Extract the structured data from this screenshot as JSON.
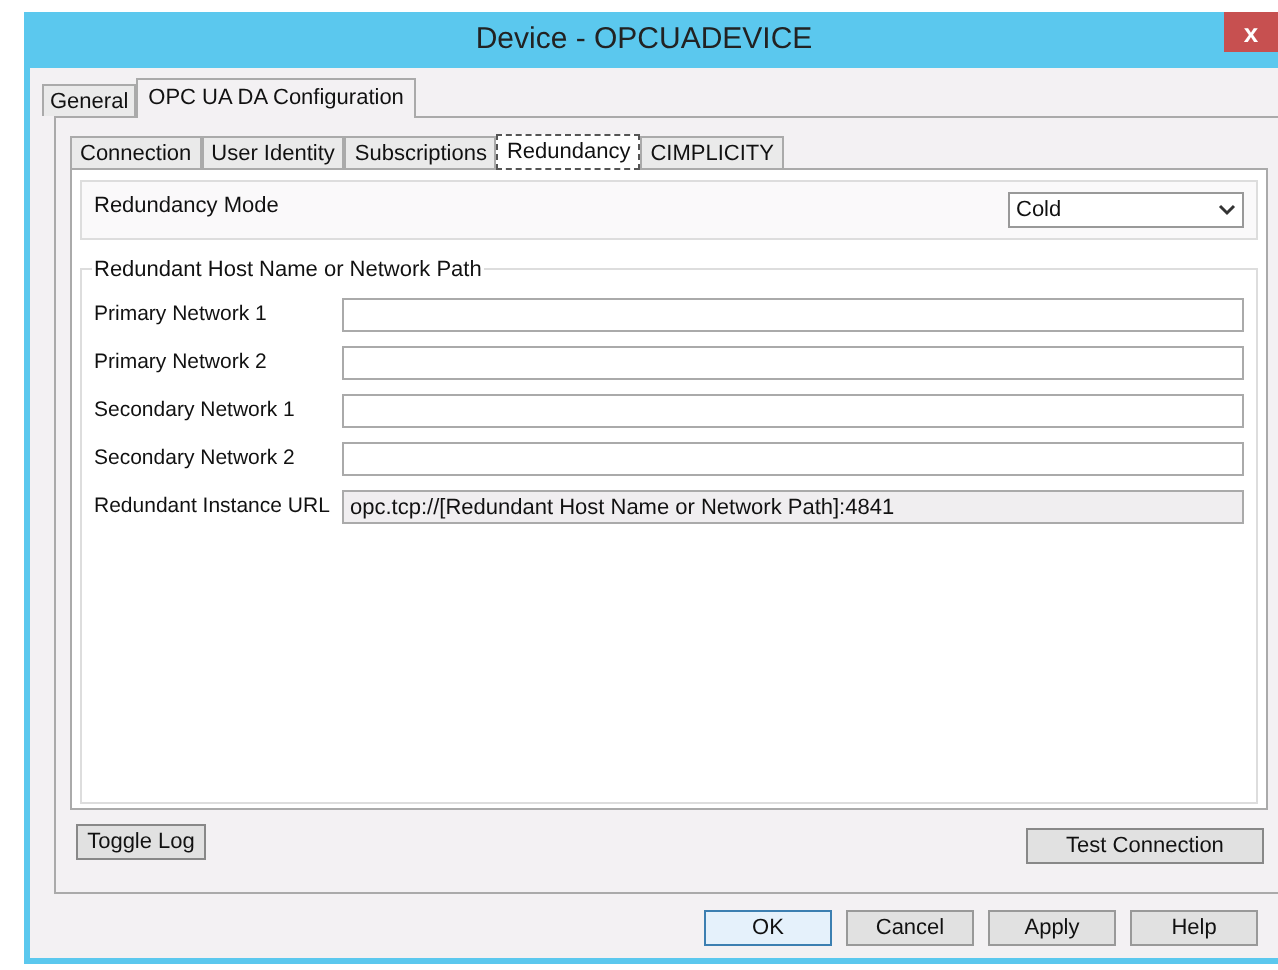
{
  "window": {
    "title": "Device - OPCUADEVICE",
    "close": "x"
  },
  "outer_tabs": [
    {
      "label": "General",
      "selected": false
    },
    {
      "label": "OPC UA DA Configuration",
      "selected": true
    }
  ],
  "inner_tabs": [
    {
      "label": "Connection",
      "selected": false
    },
    {
      "label": "User Identity",
      "selected": false
    },
    {
      "label": "Subscriptions",
      "selected": false
    },
    {
      "label": "Redundancy",
      "selected": true
    },
    {
      "label": "CIMPLICITY",
      "selected": false
    }
  ],
  "redundancy_mode": {
    "label": "Redundancy Mode",
    "value": "Cold"
  },
  "group": {
    "title": "Redundant Host Name or Network Path"
  },
  "fields": [
    {
      "label": "Primary Network 1",
      "disabled": false
    },
    {
      "label": "Primary Network 2",
      "disabled": false
    },
    {
      "label": "Secondary Network 1",
      "disabled": false
    },
    {
      "label": "Secondary Network 2",
      "disabled": false
    },
    {
      "label": "Redundant Instance URL",
      "value": "opc.tcp://[Redundant Host Name or Network Path]:4841",
      "disabled": true
    }
  ],
  "panel_buttons": [
    {
      "label": "Toggle Log"
    },
    {
      "label": "Test Connection"
    }
  ],
  "dialog_buttons": [
    {
      "label": "OK",
      "default": true
    },
    {
      "label": "Cancel",
      "default": false
    },
    {
      "label": "Apply",
      "default": false
    },
    {
      "label": "Help",
      "default": false
    }
  ]
}
